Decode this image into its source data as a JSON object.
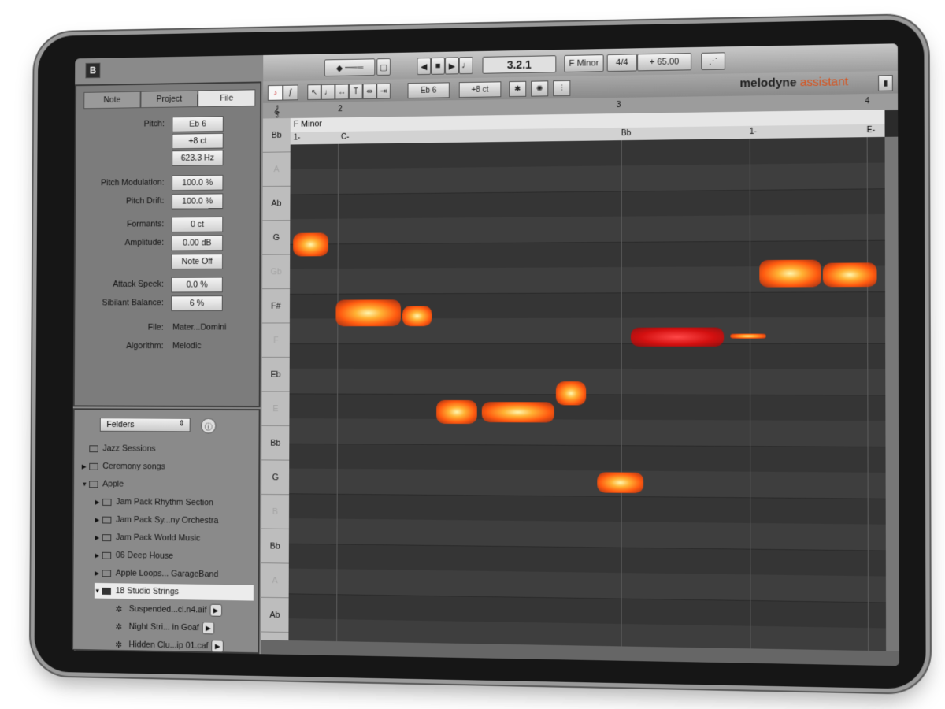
{
  "app_icon": "B",
  "inspector": {
    "tabs": [
      "Note",
      "Project",
      "File"
    ],
    "active_tab": "File",
    "params": [
      {
        "label": "Pitch:",
        "value": "Eb 6"
      },
      {
        "label": "",
        "value": "+8 ct"
      },
      {
        "label": "",
        "value": "623.3 Hz"
      },
      {
        "label": "Pitch Modulation:",
        "value": "100.0 %"
      },
      {
        "label": "Pitch Drift:",
        "value": "100.0 %"
      },
      {
        "label": "Formants:",
        "value": "0 ct"
      },
      {
        "label": "Amplitude:",
        "value": "0.00 dB"
      },
      {
        "label": "",
        "value": "Note Off"
      },
      {
        "label": "Attack Speek:",
        "value": "0.0 %"
      },
      {
        "label": "Sibilant Balance:",
        "value": "6 %"
      }
    ],
    "file_label": "File:",
    "file_value": "Mater...Domini",
    "algorithm_label": "Algorithm:",
    "algorithm_value": "Melodic"
  },
  "browser": {
    "selector": "Felders",
    "items": [
      {
        "label": "Jazz Sessions",
        "indent": 0,
        "arrow": "",
        "kind": "folder"
      },
      {
        "label": "Ceremony songs",
        "indent": 0,
        "arrow": "▶",
        "kind": "folder"
      },
      {
        "label": "Apple",
        "indent": 0,
        "arrow": "▼",
        "kind": "folder"
      },
      {
        "label": "Jam Pack Rhythm Section",
        "indent": 1,
        "arrow": "▶",
        "kind": "folder"
      },
      {
        "label": "Jam Pack Sy...ny Orchestra",
        "indent": 1,
        "arrow": "▶",
        "kind": "folder"
      },
      {
        "label": "Jam Pack World Music",
        "indent": 1,
        "arrow": "▶",
        "kind": "folder"
      },
      {
        "label": "06 Deep House",
        "indent": 1,
        "arrow": "▶",
        "kind": "folder"
      },
      {
        "label": "Apple Loops... GarageBand",
        "indent": 1,
        "arrow": "▶",
        "kind": "folder"
      },
      {
        "label": "18 Studio Strings",
        "indent": 1,
        "arrow": "▼",
        "kind": "folder-dark",
        "selected": true
      },
      {
        "label": "Suspended...cl.n4.aif",
        "indent": 2,
        "arrow": "",
        "kind": "file"
      },
      {
        "label": "Night Stri... in Goaf",
        "indent": 2,
        "arrow": "",
        "kind": "file"
      },
      {
        "label": "Hidden Clu...ip 01.caf",
        "indent": 2,
        "arrow": "",
        "kind": "file"
      }
    ]
  },
  "transport": {
    "position": "3.2.1",
    "key": "F Minor",
    "meter": "4/4",
    "tempo": "+ 65.00"
  },
  "editor_toolbar": {
    "pitch_value": "Eb 6",
    "cents_value": "+8 ct"
  },
  "logo": {
    "main": "melodyne",
    "sub": "assistant"
  },
  "ruler": {
    "bars": [
      "2",
      "3",
      "4"
    ]
  },
  "key_strip": {
    "key": "F Minor"
  },
  "chord_strip": {
    "chords": [
      "1-",
      "C-",
      "Bb",
      "1-",
      "E-"
    ]
  },
  "pitch_keys": [
    {
      "label": "Bb",
      "dim": false
    },
    {
      "label": "A",
      "dim": true
    },
    {
      "label": "Ab",
      "dim": false
    },
    {
      "label": "G",
      "dim": false
    },
    {
      "label": "Gb",
      "dim": true
    },
    {
      "label": "F#",
      "dim": false
    },
    {
      "label": "F",
      "dim": true
    },
    {
      "label": "Eb",
      "dim": false
    },
    {
      "label": "E",
      "dim": true
    },
    {
      "label": "Bb",
      "dim": false
    },
    {
      "label": "G",
      "dim": false
    },
    {
      "label": "B",
      "dim": true
    },
    {
      "label": "Bb",
      "dim": false
    },
    {
      "label": "A",
      "dim": true
    },
    {
      "label": "Ab",
      "dim": false
    }
  ]
}
